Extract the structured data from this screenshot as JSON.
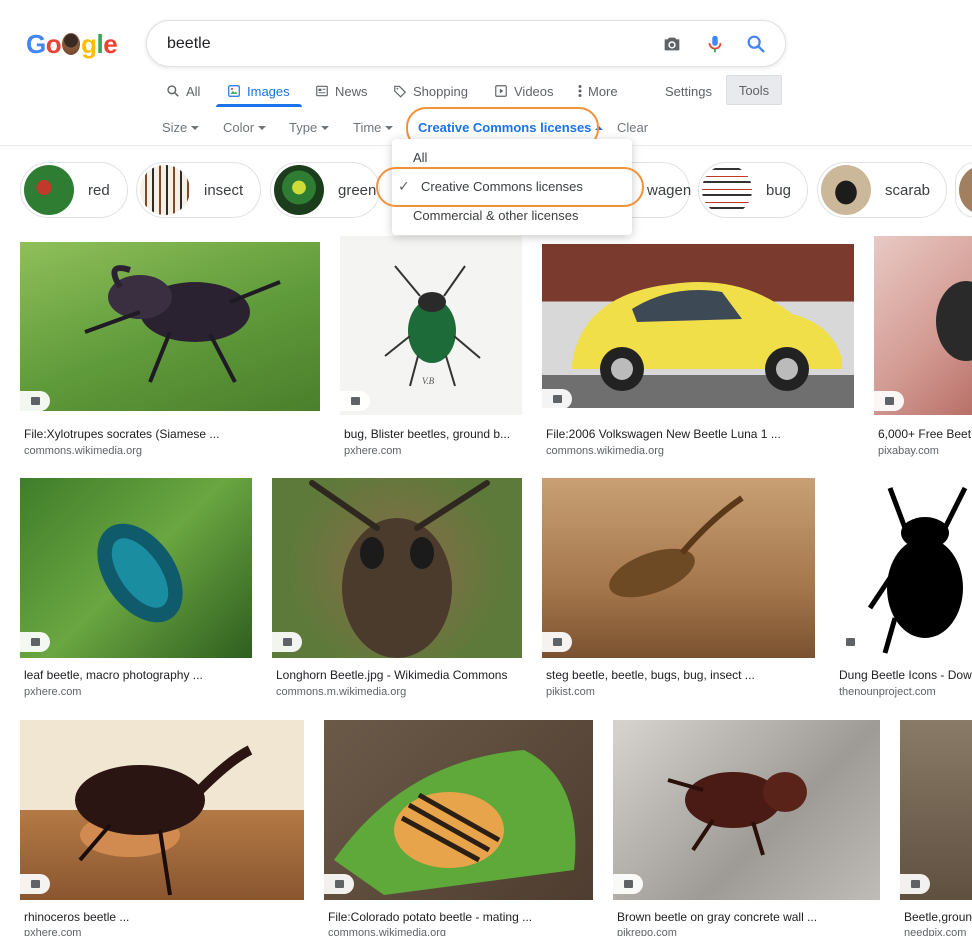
{
  "logo": {
    "letters": [
      "G",
      "o",
      "g",
      "l",
      "e"
    ],
    "colors": [
      "#4285f4",
      "#ea4335",
      "#fbbc05",
      "#34a853",
      "#ea4335"
    ]
  },
  "search": {
    "query": "beetle"
  },
  "tabs": [
    {
      "label": "All",
      "icon": "search-icon"
    },
    {
      "label": "Images",
      "icon": "image-icon"
    },
    {
      "label": "News",
      "icon": "news-icon"
    },
    {
      "label": "Shopping",
      "icon": "tag-icon"
    },
    {
      "label": "Videos",
      "icon": "video-icon"
    },
    {
      "label": "More",
      "icon": "more-icon"
    }
  ],
  "settings_label": "Settings",
  "tools_label": "Tools",
  "filters": {
    "size": "Size",
    "color": "Color",
    "type": "Type",
    "time": "Time",
    "license": "Creative Commons licenses",
    "clear": "Clear"
  },
  "dropdown": {
    "items": [
      "All",
      "Creative Commons licenses",
      "Commercial & other licenses"
    ],
    "selected": "Creative Commons licenses"
  },
  "chips": [
    {
      "label": "red"
    },
    {
      "label": "insect"
    },
    {
      "label": "green"
    },
    {
      "label": "wagen"
    },
    {
      "label": "bug"
    },
    {
      "label": "scarab"
    }
  ],
  "results": [
    {
      "title": "File:Xylotrupes socrates (Siamese ...",
      "site": "commons.wikimedia.org"
    },
    {
      "title": "bug, Blister beetles, ground b...",
      "site": "pxhere.com"
    },
    {
      "title": "File:2006 Volkswagen New Beetle Luna 1 ...",
      "site": "commons.wikimedia.org"
    },
    {
      "title": "6,000+ Free Beet",
      "site": "pixabay.com"
    },
    {
      "title": "leaf beetle, macro photography ...",
      "site": "pxhere.com"
    },
    {
      "title": "Longhorn Beetle.jpg - Wikimedia Commons",
      "site": "commons.m.wikimedia.org"
    },
    {
      "title": "steg beetle, beetle, bugs, bug, insect ...",
      "site": "pikist.com"
    },
    {
      "title": "Dung Beetle Icons - Dow",
      "site": "thenounproject.com"
    },
    {
      "title": "rhinoceros beetle ...",
      "site": "pxhere.com"
    },
    {
      "title": "File:Colorado potato beetle - mating ...",
      "site": "commons.wikimedia.org"
    },
    {
      "title": "Brown beetle on gray concrete wall ...",
      "site": "pikrepo.com"
    },
    {
      "title": "Beetle,groun",
      "site": "needpix.com"
    }
  ],
  "image_caption": "V.B"
}
